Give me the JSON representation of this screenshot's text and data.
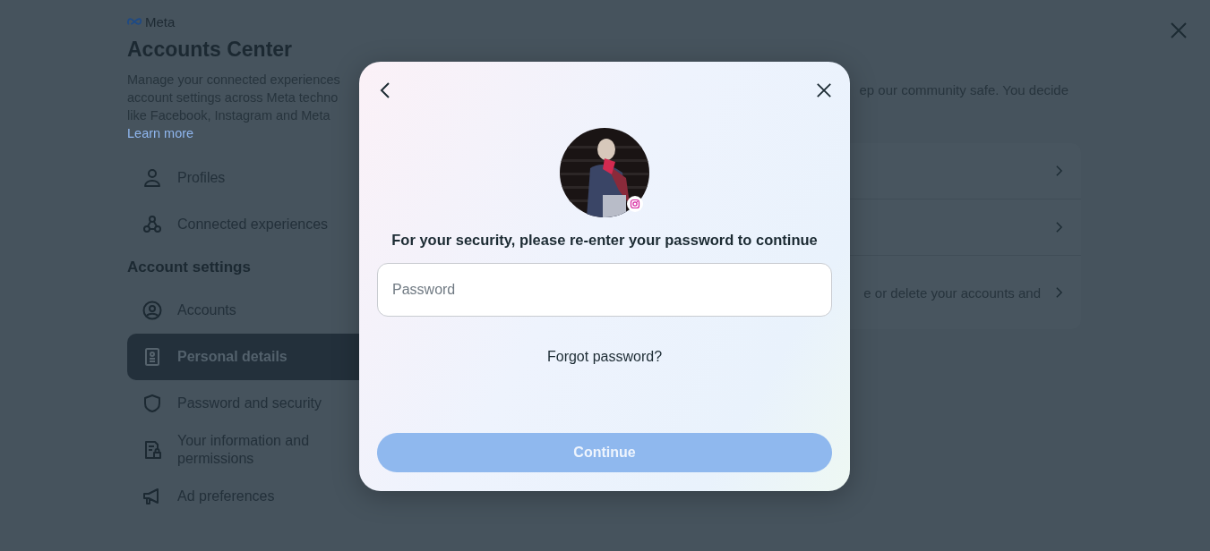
{
  "brand": "Meta",
  "sidebar": {
    "title": "Accounts Center",
    "description": "Manage your connected experiences\naccount settings across Meta techno\nlike Facebook, Instagram and Meta",
    "link": "Learn more",
    "items": [
      {
        "label": "Profiles",
        "selected": false
      },
      {
        "label": "Connected experiences",
        "selected": false
      }
    ],
    "section": "Account settings",
    "settings": [
      {
        "label": "Accounts",
        "selected": false
      },
      {
        "label": "Personal details",
        "selected": true
      },
      {
        "label": "Password and security",
        "selected": false
      },
      {
        "label": "Your information and permissions",
        "selected": false
      },
      {
        "label": "Ad preferences",
        "selected": false
      }
    ]
  },
  "main": {
    "description": "ep our community safe. You decide",
    "rows": [
      {},
      {},
      {
        "text": "e or delete your accounts and"
      }
    ]
  },
  "dialog": {
    "prompt": "For your security, please re-enter your password to continue",
    "password": {
      "placeholder": "Password"
    },
    "forgot_link": "Forgot password?",
    "continue_button": {
      "label": "Continue",
      "disabled": true
    }
  }
}
